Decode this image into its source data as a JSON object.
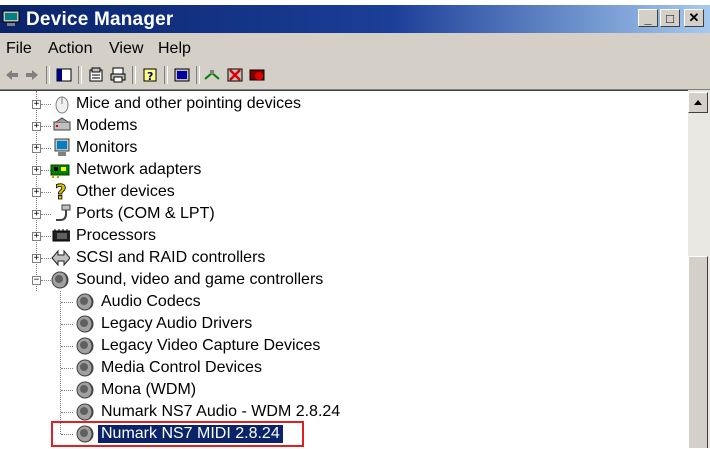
{
  "window": {
    "title": "Device Manager"
  },
  "titlebar_buttons": {
    "minimize": "_",
    "maximize": "□",
    "close": "✕"
  },
  "menu": [
    {
      "label": "File"
    },
    {
      "label": "Action"
    },
    {
      "label": "View"
    },
    {
      "label": "Help"
    }
  ],
  "tree": {
    "categories": [
      {
        "label": "Mice and other pointing devices",
        "icon": "mouse-icon"
      },
      {
        "label": "Modems",
        "icon": "modem-icon"
      },
      {
        "label": "Monitors",
        "icon": "monitor-icon"
      },
      {
        "label": "Network adapters",
        "icon": "network-adapter-icon"
      },
      {
        "label": "Other devices",
        "icon": "question-icon"
      },
      {
        "label": "Ports (COM & LPT)",
        "icon": "port-icon"
      },
      {
        "label": "Processors",
        "icon": "processor-icon"
      },
      {
        "label": "SCSI and RAID controllers",
        "icon": "scsi-icon"
      },
      {
        "label": "Sound, video and game controllers",
        "icon": "speaker-icon"
      }
    ],
    "sound_children": [
      {
        "label": "Audio Codecs"
      },
      {
        "label": "Legacy Audio Drivers"
      },
      {
        "label": "Legacy Video Capture Devices"
      },
      {
        "label": "Media Control Devices"
      },
      {
        "label": "Mona (WDM)"
      },
      {
        "label": "Numark NS7 Audio - WDM 2.8.24"
      },
      {
        "label": "Numark NS7 MIDI 2.8.24"
      }
    ]
  },
  "colors": {
    "titlebar": "#0a246a",
    "chrome": "#d4d0c8",
    "selection": "#0a246a",
    "highlight_box": "#e02020"
  }
}
